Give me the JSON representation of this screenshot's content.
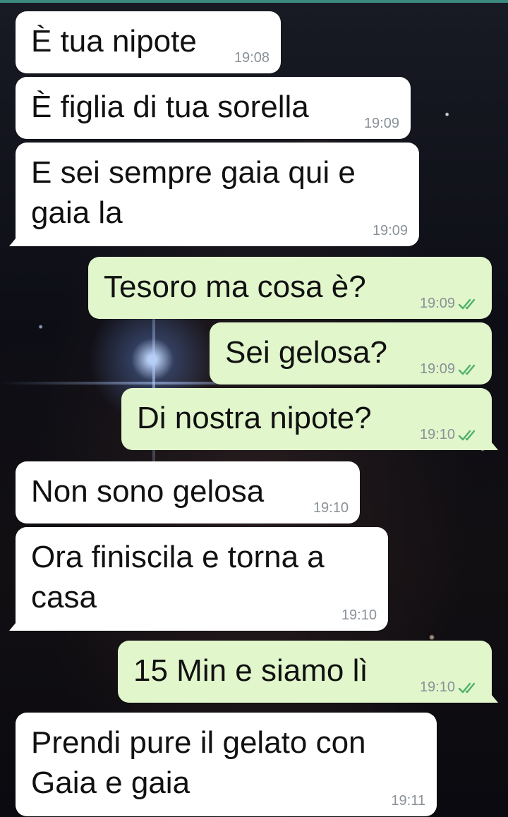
{
  "colors": {
    "incoming_bubble": "#ffffff",
    "outgoing_bubble": "#e1f6cb",
    "read_ticks": "#4fb06a",
    "timestamp": "#8a9198",
    "top_bar": "#3c8a7f"
  },
  "read_receipt_icon": "double-check-icon",
  "messages": [
    {
      "direction": "incoming",
      "text": "È tua nipote",
      "time": "19:08"
    },
    {
      "direction": "incoming",
      "text": "È figlia di tua sorella",
      "time": "19:09"
    },
    {
      "direction": "incoming",
      "text": "E sei sempre gaia qui e\ngaia la",
      "time": "19:09"
    },
    {
      "direction": "outgoing",
      "text": "Tesoro ma cosa è?",
      "time": "19:09",
      "status": "read"
    },
    {
      "direction": "outgoing",
      "text": "Sei gelosa?",
      "time": "19:09",
      "status": "read"
    },
    {
      "direction": "outgoing",
      "text": "Di nostra nipote?",
      "time": "19:10",
      "status": "read"
    },
    {
      "direction": "incoming",
      "text": "Non sono gelosa",
      "time": "19:10"
    },
    {
      "direction": "incoming",
      "text": "Ora finiscila e torna a\ncasa",
      "time": "19:10"
    },
    {
      "direction": "outgoing",
      "text": "15 Min e siamo lì",
      "time": "19:10",
      "status": "read"
    },
    {
      "direction": "incoming",
      "text": "Prendi pure il gelato con\nGaia e gaia",
      "time": "19:11"
    }
  ]
}
